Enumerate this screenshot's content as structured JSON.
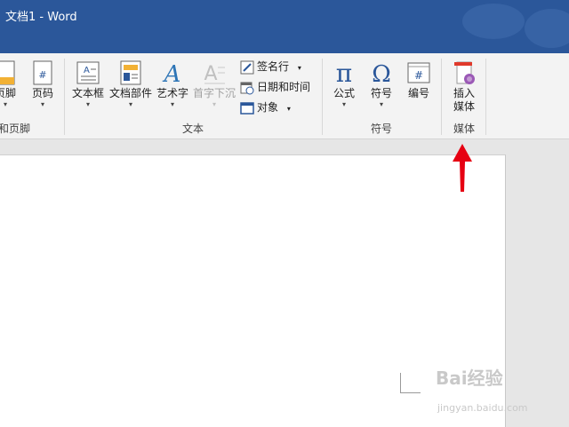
{
  "window": {
    "title": "文档1 - Word"
  },
  "ribbon": {
    "header_footer": {
      "footer_label": "页脚",
      "page_number_label": "页码",
      "group_label": "和页脚"
    },
    "text": {
      "textbox_label": "文本框",
      "quick_parts_label": "文档部件",
      "wordart_label": "艺术字",
      "dropcap_label": "首字下沉",
      "signature_label": "签名行",
      "datetime_label": "日期和时间",
      "object_label": "对象",
      "group_label": "文本"
    },
    "symbols": {
      "equation_label": "公式",
      "symbol_label": "符号",
      "number_label": "编号",
      "group_label": "符号"
    },
    "media": {
      "insert_label_line1": "插入",
      "insert_label_line2": "媒体",
      "group_label": "媒体"
    }
  },
  "watermark": {
    "brand": "Bai经验",
    "url": "jingyan.baidu.com"
  },
  "colors": {
    "titlebar": "#2b579a",
    "arrow": "#e60012"
  }
}
